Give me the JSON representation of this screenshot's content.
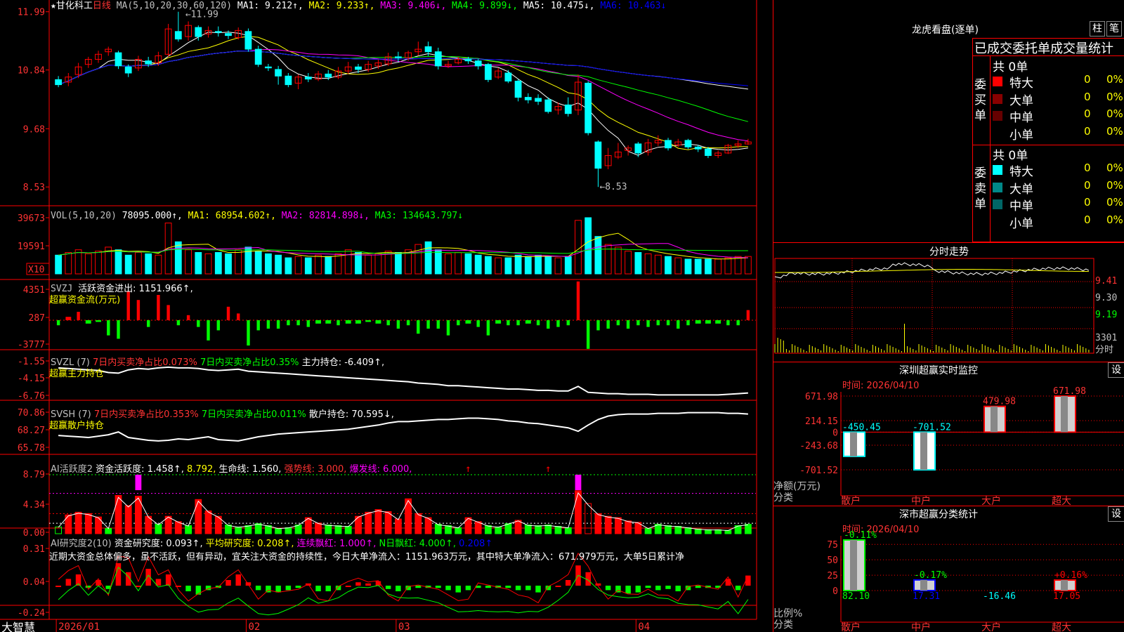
{
  "colors": {
    "up": "#ff0000",
    "down": "#00ffff",
    "ma1": "#ffffff",
    "ma2": "#ffff00",
    "ma3": "#ff00ff",
    "ma4": "#00ff00",
    "ma5": "#ffffff",
    "ma6": "#0000ff",
    "axis": "#ff0000",
    "label": "#ff3333",
    "green": "#00ff00",
    "magenta": "#ff00ff",
    "yellow": "#ffff00"
  },
  "kline": {
    "title_star": "★",
    "stock_name": "甘化科工",
    "period": "日线",
    "ma_label": "MA(5,10,20,30,60,120)",
    "ma1": "MA1: 9.212↑,",
    "ma2": "MA2: 9.233↑,",
    "ma3": "MA3: 9.406↓,",
    "ma4": "MA4: 9.899↓,",
    "ma5": "MA5: 10.475↓,",
    "ma6": "MA6: 10.463↓",
    "y_ticks": [
      "11.99",
      "10.84",
      "9.68",
      "8.53"
    ],
    "y_values": [
      11.99,
      10.84,
      9.68,
      8.53
    ],
    "high_label": "11.99",
    "low_label": "8.53",
    "candles": [
      [
        10.65,
        10.55,
        10.72,
        10.5
      ],
      [
        10.6,
        10.7,
        10.78,
        10.52
      ],
      [
        10.75,
        10.9,
        10.98,
        10.68
      ],
      [
        10.95,
        11.05,
        11.1,
        10.88
      ],
      [
        11.05,
        11.15,
        11.22,
        10.98
      ],
      [
        11.2,
        11.25,
        11.3,
        11.12
      ],
      [
        11.18,
        10.92,
        11.22,
        10.86
      ],
      [
        10.9,
        10.78,
        10.95,
        10.7
      ],
      [
        10.88,
        11.05,
        11.12,
        10.82
      ],
      [
        11.02,
        10.96,
        11.1,
        10.9
      ],
      [
        10.98,
        11.12,
        11.2,
        10.92
      ],
      [
        11.15,
        11.65,
        11.75,
        11.1
      ],
      [
        11.6,
        11.45,
        11.99,
        11.4
      ],
      [
        11.5,
        11.72,
        11.8,
        11.42
      ],
      [
        11.68,
        11.5,
        11.72,
        11.42
      ],
      [
        11.55,
        11.62,
        11.7,
        11.48
      ],
      [
        11.6,
        11.58,
        11.7,
        11.5
      ],
      [
        11.56,
        11.52,
        11.62,
        11.45
      ],
      [
        11.48,
        11.62,
        11.68,
        11.44
      ],
      [
        11.6,
        11.25,
        11.66,
        11.2
      ],
      [
        11.25,
        10.95,
        11.32,
        10.9
      ],
      [
        10.9,
        10.88,
        10.96,
        10.82
      ],
      [
        10.85,
        10.72,
        10.92,
        10.55
      ],
      [
        10.72,
        10.55,
        10.78,
        10.5
      ],
      [
        10.58,
        10.7,
        10.75,
        10.46
      ],
      [
        10.7,
        10.66,
        10.78,
        10.6
      ],
      [
        10.66,
        10.76,
        10.82,
        10.62
      ],
      [
        10.76,
        10.7,
        10.84,
        10.64
      ],
      [
        10.7,
        10.82,
        10.9,
        10.66
      ],
      [
        10.82,
        10.9,
        11.0,
        10.76
      ],
      [
        10.9,
        10.85,
        10.96,
        10.78
      ],
      [
        10.85,
        10.95,
        11.02,
        10.8
      ],
      [
        10.92,
        10.98,
        11.05,
        10.86
      ],
      [
        10.96,
        11.1,
        11.18,
        10.92
      ],
      [
        11.1,
        11.08,
        11.2,
        11.0
      ],
      [
        11.08,
        11.18,
        11.22,
        11.02
      ],
      [
        11.2,
        11.25,
        11.4,
        11.12
      ],
      [
        11.3,
        11.2,
        11.4,
        11.12
      ],
      [
        11.2,
        10.92,
        11.28,
        10.85
      ],
      [
        10.92,
        10.95,
        11.02,
        10.88
      ],
      [
        10.98,
        11.05,
        11.1,
        10.95
      ],
      [
        11.05,
        11.02,
        11.1,
        10.96
      ],
      [
        11.02,
        10.92,
        11.06,
        10.85
      ],
      [
        10.95,
        10.65,
        10.98,
        10.6
      ],
      [
        10.7,
        10.82,
        10.88,
        10.66
      ],
      [
        10.78,
        10.62,
        10.84,
        10.58
      ],
      [
        10.62,
        10.3,
        10.66,
        10.22
      ],
      [
        10.3,
        10.25,
        10.38,
        10.18
      ],
      [
        10.28,
        10.22,
        10.36,
        10.15
      ],
      [
        10.25,
        10.02,
        10.3,
        9.98
      ],
      [
        10.05,
        10.12,
        10.2,
        9.96
      ],
      [
        10.15,
        9.98,
        10.3,
        9.92
      ],
      [
        10.05,
        10.6,
        10.75,
        9.95
      ],
      [
        10.58,
        9.6,
        10.62,
        9.55
      ],
      [
        9.42,
        8.9,
        9.45,
        8.53
      ],
      [
        8.95,
        9.15,
        9.3,
        8.88
      ],
      [
        9.12,
        9.22,
        9.4,
        9.08
      ],
      [
        9.25,
        9.3,
        9.35,
        9.15
      ],
      [
        9.38,
        9.2,
        9.42,
        9.12
      ],
      [
        9.22,
        9.4,
        9.48,
        9.15
      ],
      [
        9.4,
        9.45,
        9.55,
        9.34
      ],
      [
        9.45,
        9.3,
        9.5,
        9.25
      ],
      [
        9.36,
        9.42,
        9.48,
        9.32
      ],
      [
        9.45,
        9.32,
        9.48,
        9.28
      ],
      [
        9.32,
        9.28,
        9.36,
        9.22
      ],
      [
        9.28,
        9.15,
        9.32,
        9.1
      ],
      [
        9.15,
        9.2,
        9.25,
        9.1
      ],
      [
        9.2,
        9.35,
        9.38,
        9.18
      ],
      [
        9.35,
        9.38,
        9.45,
        9.3
      ],
      [
        9.38,
        9.42,
        9.48,
        9.36
      ]
    ]
  },
  "vol": {
    "label": "VOL(5,10,20)",
    "value": "78095.000↑,",
    "ma1": "MA1: 68954.602↑,",
    "ma2": "MA2: 82814.898↓,",
    "ma3": "MA3: 134643.797↓",
    "y_ticks": [
      "39673",
      "19591"
    ],
    "unit": "X10",
    "bars": [
      14,
      16,
      18,
      15,
      17,
      20,
      18,
      14,
      16,
      15,
      14,
      38,
      24,
      18,
      16,
      15,
      16,
      15,
      18,
      20,
      17,
      15,
      14,
      12,
      13,
      12,
      14,
      13,
      15,
      18,
      16,
      14,
      15,
      17,
      16,
      18,
      22,
      24,
      18,
      15,
      16,
      15,
      14,
      13,
      12,
      12,
      14,
      13,
      14,
      13,
      12,
      13,
      40,
      42,
      28,
      22,
      20,
      17,
      16,
      15,
      14,
      13,
      12,
      11,
      11,
      11,
      11,
      12,
      13,
      13
    ]
  },
  "svzj": {
    "label": "SVZJ",
    "title": "活跃资金进出: 1151.966↑,",
    "subtitle": "超赢资金流(万元)",
    "y_ticks": [
      "4351",
      "287",
      "-3777"
    ],
    "bars": [
      -0.3,
      0.2,
      0.5,
      -0.2,
      -0.1,
      -0.9,
      -1.1,
      1.7,
      1.2,
      -0.4,
      1.5,
      0.9,
      -0.3,
      0.3,
      -0.4,
      -1.2,
      -0.6,
      0.8,
      0.4,
      -1.5,
      -0.6,
      -0.5,
      -0.5,
      -0.3,
      -0.3,
      -0.4,
      -0.2,
      -0.2,
      -0.3,
      -0.2,
      -0.2,
      -0.1,
      -0.2,
      -0.3,
      -0.5,
      -0.3,
      -0.8,
      -0.5,
      -0.5,
      -0.9,
      -0.3,
      -0.2,
      -0.4,
      -0.9,
      -0.2,
      -0.3,
      -0.3,
      -0.2,
      -0.3,
      -0.5,
      -0.4,
      -0.3,
      2.3,
      -1.7,
      -0.6,
      -0.5,
      -0.3,
      -0.5,
      -0.3,
      -0.4,
      -0.3,
      -0.3,
      -0.5,
      -0.3,
      -0.2,
      -0.2,
      -0.2,
      -0.3,
      -0.3,
      0.6
    ]
  },
  "svzl": {
    "label": "SVZL (7)",
    "buy7": "7日内买卖净占比0.073%",
    "sell7": "7日内买卖净占比0.35%",
    "main": "主力持仓: -6.409↑,",
    "subtitle": "超赢主力持仓",
    "y_ticks": [
      "-1.55",
      "-4.15",
      "-6.76"
    ],
    "line": [
      -2.6,
      -2.7,
      -2.8,
      -2.9,
      -3.0,
      -3.3,
      -3.4,
      -2.9,
      -2.7,
      -2.8,
      -2.6,
      -2.5,
      -2.6,
      -2.6,
      -2.7,
      -2.9,
      -3.0,
      -2.9,
      -2.8,
      -3.1,
      -3.2,
      -3.3,
      -3.4,
      -3.5,
      -3.6,
      -3.7,
      -3.8,
      -3.9,
      -4.0,
      -4.1,
      -4.2,
      -4.3,
      -4.4,
      -4.5,
      -4.6,
      -4.7,
      -4.9,
      -5.0,
      -5.1,
      -5.3,
      -5.3,
      -5.4,
      -5.5,
      -5.6,
      -5.7,
      -5.8,
      -5.8,
      -5.9,
      -6.0,
      -6.0,
      -6.1,
      -6.1,
      -5.4,
      -6.3,
      -6.4,
      -6.5,
      -6.5,
      -6.6,
      -6.6,
      -6.6,
      -6.7,
      -6.7,
      -6.7,
      -6.7,
      -6.7,
      -6.7,
      -6.7,
      -6.6,
      -6.5,
      -6.4
    ]
  },
  "svsh": {
    "label": "SVSH (7)",
    "buy7": "7日内买卖净占比0.353%",
    "sell7": "7日内买卖净占比0.011%",
    "retail": "散户持仓: 70.595↓,",
    "subtitle": "超赢散户持仓",
    "y_ticks": [
      "70.86",
      "68.27",
      "65.78"
    ],
    "line": [
      67.5,
      67.4,
      67.3,
      67.2,
      67.4,
      67.6,
      68.0,
      67.2,
      67.0,
      66.8,
      66.7,
      66.8,
      67.0,
      66.9,
      67.1,
      67.3,
      66.9,
      66.8,
      66.7,
      67.0,
      67.3,
      67.5,
      67.7,
      67.8,
      67.9,
      68.0,
      68.1,
      68.2,
      68.3,
      68.4,
      68.6,
      68.8,
      69.0,
      69.3,
      69.5,
      69.5,
      69.6,
      69.7,
      69.8,
      69.8,
      69.9,
      70.0,
      70.0,
      69.9,
      69.8,
      69.6,
      69.5,
      69.3,
      69.2,
      69.0,
      68.8,
      68.6,
      68.1,
      69.0,
      69.8,
      70.3,
      70.5,
      70.6,
      70.6,
      70.6,
      70.7,
      70.7,
      70.7,
      70.8,
      70.8,
      70.8,
      70.8,
      70.7,
      70.7,
      70.6
    ]
  },
  "ai_active": {
    "label": "AI活跃度2",
    "activity": "资金活跃度: 1.458↑,",
    "v2": "8.792,",
    "life": "生命线: 1.560,",
    "strong": "强势线: 3.000,",
    "burst": "爆发线: 6.000,",
    "y_ticks": [
      "8.79",
      "4.34",
      "0.00"
    ],
    "bars": [
      1.0,
      2.8,
      3.2,
      3.0,
      2.5,
      0.8,
      5.7,
      4.2,
      5.6,
      2.6,
      1.4,
      2.6,
      1.8,
      1.2,
      5.1,
      3.4,
      2.6,
      1.3,
      1.0,
      1.2,
      1.5,
      1.2,
      0.8,
      0.9,
      1.3,
      2.4,
      1.6,
      1.3,
      1.2,
      1.1,
      2.6,
      3.2,
      3.6,
      3.3,
      2.2,
      5.2,
      3.0,
      2.4,
      1.4,
      1.2,
      0.9,
      2.4,
      1.8,
      1.2,
      1.0,
      1.5,
      2.0,
      1.3,
      1.2,
      1.3,
      1.1,
      0.9,
      6.4,
      4.5,
      3.0,
      2.6,
      2.4,
      1.9,
      1.7,
      0.8,
      1.4,
      1.2,
      1.1,
      0.9,
      0.7,
      0.6,
      0.6,
      0.5,
      1.2,
      1.4
    ],
    "peaks": [
      8,
      52
    ]
  },
  "ai_research": {
    "label": "AI研究度2(10)",
    "research": "资金研究度: 0.093↑,",
    "avg": "平均研究度: 0.208↑,",
    "lian": "连续飘红: 1.000↑,",
    "nday": "N日飘红: 4.000↑,",
    "other": "0.208↑",
    "comment": "近期大资金总体偏多，虽不活跃，但有异动，宜关注大资金的持续性，今日大单净流入：1151.963万元，其中特大单净流入：671.979万元，大单5日累计净",
    "y_ticks": [
      "0.31",
      "0.04",
      "-0.24"
    ],
    "bars": [
      0.0,
      0.06,
      0.1,
      -0.02,
      0.05,
      -0.03,
      0.2,
      0.12,
      0.0,
      0.15,
      0.06,
      0.1,
      0.0,
      -0.05,
      -0.08,
      -0.04,
      -0.02,
      0.05,
      0.1,
      0.03,
      -0.04,
      -0.06,
      -0.06,
      -0.04,
      -0.02,
      0.02,
      -0.05,
      -0.05,
      -0.04,
      0.0,
      0.03,
      0.02,
      0.04,
      -0.03,
      -0.05,
      -0.04,
      -0.02,
      -0.02,
      -0.02,
      -0.04,
      -0.06,
      -0.04,
      -0.02,
      -0.02,
      -0.02,
      -0.02,
      -0.04,
      -0.04,
      -0.06,
      -0.04,
      0.0,
      0.05,
      0.18,
      0.12,
      0.02,
      -0.04,
      -0.06,
      -0.07,
      -0.06,
      -0.02,
      -0.04,
      -0.03,
      -0.05,
      -0.04,
      -0.02,
      -0.02,
      -0.02,
      0.06,
      -0.04,
      0.09
    ]
  },
  "xaxis": {
    "labels": [
      "2026/01",
      "02",
      "03",
      "04"
    ],
    "positions": [
      0,
      19,
      34,
      58
    ]
  },
  "brand": "大智慧",
  "dragon": {
    "title": "龙虎看盘(逐单)",
    "btn1": "柱",
    "btn2": "笔",
    "header": "已成交委托单成交量统计",
    "buy_side": "委买单",
    "sell_side": "委卖单",
    "buy_total": "共 0单",
    "sell_total": "共 0单",
    "buy_rows": [
      {
        "name": "特大",
        "color": "#ff0000",
        "count": "0",
        "pct": "0%"
      },
      {
        "name": "大单",
        "color": "#880000",
        "count": "0",
        "pct": "0%"
      },
      {
        "name": "中单",
        "color": "#660000",
        "count": "0",
        "pct": "0%"
      },
      {
        "name": "小单",
        "color": "",
        "count": "0",
        "pct": "0%"
      }
    ],
    "sell_rows": [
      {
        "name": "特大",
        "color": "#00ffff",
        "count": "0",
        "pct": "0%"
      },
      {
        "name": "大单",
        "color": "#008888",
        "count": "0",
        "pct": "0%"
      },
      {
        "name": "中单",
        "color": "#006666",
        "count": "0",
        "pct": "0%"
      },
      {
        "name": "小单",
        "color": "",
        "count": "0",
        "pct": "0%"
      }
    ]
  },
  "intraday": {
    "title": "分时走势",
    "y_ticks": [
      "9.41",
      "9.30",
      "9.19"
    ],
    "vol_label": "3301",
    "bottom_label": "分时"
  },
  "sz_monitor": {
    "title": "深圳超赢实时监控",
    "btn": "设",
    "time_label": "时间: 2026/04/10",
    "y_ticks": [
      "671.98",
      "214.15",
      "0",
      "-243.68",
      "-701.52"
    ],
    "bars": [
      {
        "cat": "散户",
        "value": -450.45,
        "label": "-450.45"
      },
      {
        "cat": "中户",
        "value": -701.52,
        "label": "-701.52"
      },
      {
        "cat": "大户",
        "value": 479.98,
        "label": "479.98"
      },
      {
        "cat": "超大",
        "value": 671.98,
        "label": "671.98"
      }
    ],
    "ylim": [
      -701.52,
      671.98
    ],
    "y_label": "净额(万元)",
    "x_label": "分类"
  },
  "sh_stats": {
    "title": "深市超赢分类统计",
    "btn": "设",
    "time_label": "时间: 2026/04/10",
    "y_ticks": [
      "75",
      "50",
      "25",
      "0"
    ],
    "bars": [
      {
        "cat": "散户",
        "value": 82.1,
        "label": "82.10",
        "delta": "-0.11%",
        "color": "#00ff00"
      },
      {
        "cat": "中户",
        "value": 17.31,
        "label": "17.31",
        "delta": "-0.17%",
        "color": "#0000ff"
      },
      {
        "cat": "大户",
        "value": 0,
        "label": "-16.46",
        "delta": "",
        "color": "#00ffff"
      },
      {
        "cat": "超大",
        "value": 17.05,
        "label": "17.05",
        "delta": "+0.16%",
        "color": "#ff0000"
      }
    ],
    "y_label": "比例%",
    "x_label": "分类"
  }
}
